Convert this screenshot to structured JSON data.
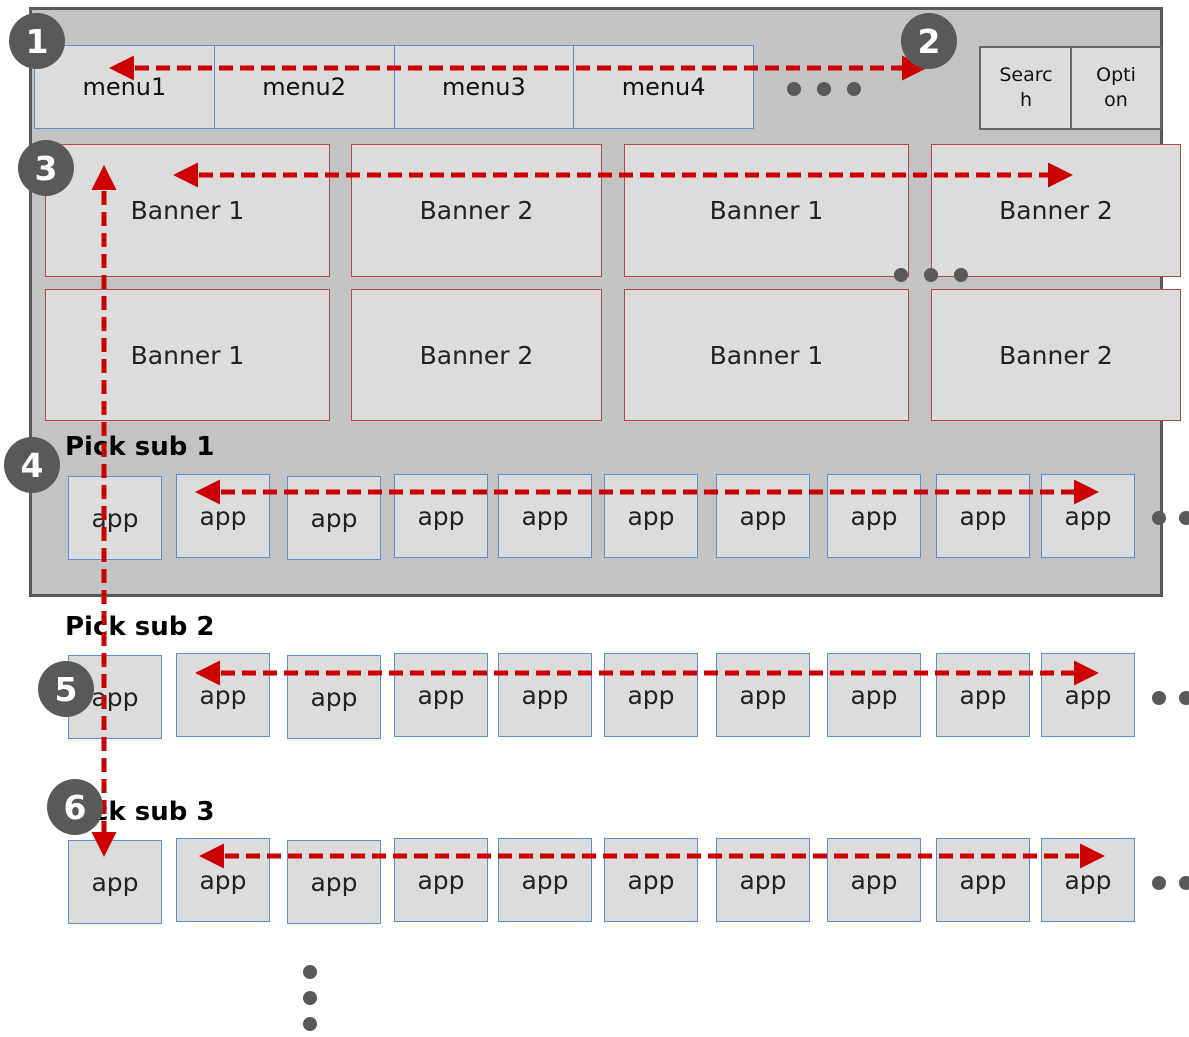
{
  "menu": [
    "menu1",
    "menu2",
    "menu3",
    "menu4"
  ],
  "buttons": {
    "search": "Searc\nh",
    "option": "Opti\non"
  },
  "banners": [
    "Banner 1",
    "Banner 2",
    "Banner 1",
    "Banner 2",
    "Banner 1",
    "Banner 2",
    "Banner 1",
    "Banner 2"
  ],
  "rows": [
    {
      "title": "Pick sub 1",
      "apps": [
        "app",
        "app",
        "app",
        "app",
        "app",
        "app",
        "app",
        "app",
        "app",
        "app"
      ]
    },
    {
      "title": "Pick sub 2",
      "apps": [
        "app",
        "app",
        "app",
        "app",
        "app",
        "app",
        "app",
        "app",
        "app",
        "app"
      ]
    },
    {
      "title": "Pick sub 3",
      "apps": [
        "app",
        "app",
        "app",
        "app",
        "app",
        "app",
        "app",
        "app",
        "app",
        "app"
      ]
    }
  ],
  "badges": [
    "1",
    "2",
    "3",
    "4",
    "5",
    "6"
  ],
  "colors": {
    "arrow": "#cc0000",
    "frame": "#595959",
    "frame_bg": "#c3c3c3",
    "box_bg": "#dcdcdc",
    "menu_border": "#5b8fd0",
    "banner_border": "#b04a4a"
  }
}
